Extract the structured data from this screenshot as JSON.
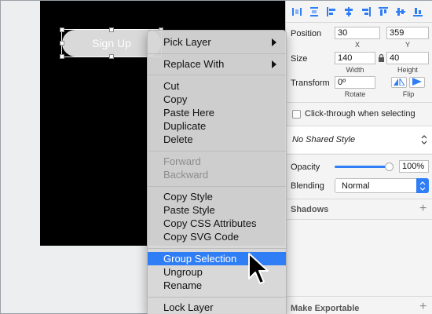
{
  "canvas": {
    "button_label": "Sign Up"
  },
  "context_menu": {
    "items": [
      {
        "label": "Pick Layer",
        "submenu": true
      },
      {
        "label": "Replace With",
        "submenu": true
      },
      {
        "label": "Cut"
      },
      {
        "label": "Copy"
      },
      {
        "label": "Paste Here"
      },
      {
        "label": "Duplicate"
      },
      {
        "label": "Delete"
      },
      {
        "label": "Forward",
        "disabled": true
      },
      {
        "label": "Backward",
        "disabled": true
      },
      {
        "label": "Copy Style"
      },
      {
        "label": "Paste Style"
      },
      {
        "label": "Copy CSS Attributes"
      },
      {
        "label": "Copy SVG Code"
      },
      {
        "label": "Group Selection",
        "highlighted": true
      },
      {
        "label": "Ungroup"
      },
      {
        "label": "Rename"
      },
      {
        "label": "Lock Layer"
      }
    ]
  },
  "inspector": {
    "position_label": "Position",
    "x_value": "30",
    "y_value": "359",
    "x_label": "X",
    "y_label": "Y",
    "size_label": "Size",
    "width_value": "140",
    "height_value": "40",
    "width_label": "Width",
    "height_label": "Height",
    "transform_label": "Transform",
    "rotate_value": "0º",
    "rotate_label": "Rotate",
    "flip_label": "Flip",
    "click_through_label": "Click-through when selecting",
    "shared_style_value": "No Shared Style",
    "opacity_label": "Opacity",
    "opacity_value": "100%",
    "opacity_level": 1.0,
    "blending_label": "Blending",
    "blending_value": "Normal",
    "shadows_label": "Shadows",
    "exportable_label": "Make Exportable"
  },
  "colors": {
    "highlight": "#2f7ef5",
    "canvas_bg": "#000000",
    "button_fill": "#d9d9d9"
  }
}
